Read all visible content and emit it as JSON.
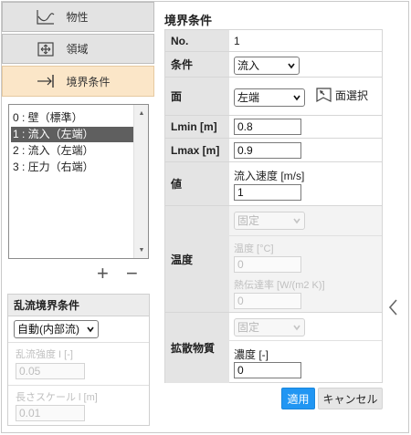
{
  "nav": {
    "items": [
      {
        "label": "物性",
        "icon": "graph-icon",
        "active": false
      },
      {
        "label": "領域",
        "icon": "domain-icon",
        "active": false
      },
      {
        "label": "境界条件",
        "icon": "boundary-arrow-icon",
        "active": true
      }
    ]
  },
  "boundary_list": {
    "items": [
      "0 : 壁（標準）",
      "1 : 流入（左端）",
      "2 : 流入（左端）",
      "3 : 圧力（右端）"
    ],
    "selected_index": 1,
    "add_label": "+",
    "remove_label": "−"
  },
  "turbulence": {
    "title": "乱流境界条件",
    "mode_value": "自動(内部流)",
    "intensity_label": "乱流強度 I [-]",
    "intensity_value": "0.05",
    "length_label": "長さスケール l [m]",
    "length_value": "0.01"
  },
  "panel": {
    "title": "境界条件",
    "no_label": "No.",
    "no_value": "1",
    "condition_label": "条件",
    "condition_value": "流入",
    "face_label": "面",
    "face_value": "左端",
    "face_select_label": "面選択",
    "lmin_label": "Lmin [m]",
    "lmin_value": "0.8",
    "lmax_label": "Lmax [m]",
    "lmax_value": "0.9",
    "value_label": "値",
    "inflow_label": "流入速度 [m/s]",
    "inflow_value": "1",
    "temp_label": "温度",
    "temp_mode": "固定",
    "temp_field_label": "温度 [°C]",
    "temp_value": "0",
    "heat_rate_label": "熱伝達率 [W/(m2 K)]",
    "heat_rate_value": "0",
    "diffusion_label": "拡散物質",
    "diffusion_mode": "固定",
    "concentration_label": "濃度 [-]",
    "concentration_value": "0"
  },
  "buttons": {
    "apply": "適用",
    "cancel": "キャンセル"
  },
  "colors": {
    "accent": "#2196f3",
    "active_nav": "#fbe6c8",
    "header_cell": "#e4e4e4",
    "selected_row": "#5f5f5f"
  }
}
